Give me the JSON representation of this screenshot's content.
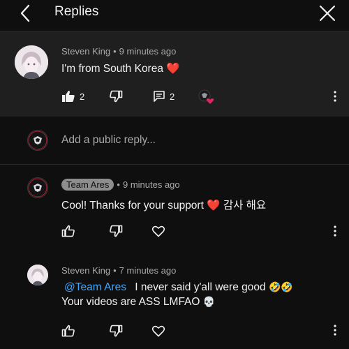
{
  "header": {
    "title": "Replies"
  },
  "top_comment": {
    "author": "Steven King",
    "time": "9 minutes ago",
    "text": "I'm from South Korea",
    "heart_emoji": "❤️",
    "likes": "2",
    "replies": "2"
  },
  "reply_input": {
    "placeholder": "Add a public reply..."
  },
  "replies": [
    {
      "author": "Team Ares",
      "time": "9 minutes ago",
      "text": "Cool! Thanks for your support",
      "heart_emoji": "❤️",
      "korean": "감사 해요"
    },
    {
      "author": "Steven King",
      "time": "7 minutes ago",
      "mention": "@Team Ares",
      "line1": "I never said y'all were good",
      "line1_emoji": "🤣🤣",
      "line2": "Your videos are ASS LMFAO",
      "line2_emoji": "💀"
    }
  ],
  "colors": {
    "background": "#0f0f0f",
    "highlight": "#1f1f1f",
    "mention": "#3ea6ff",
    "heart": "#e0245e"
  }
}
